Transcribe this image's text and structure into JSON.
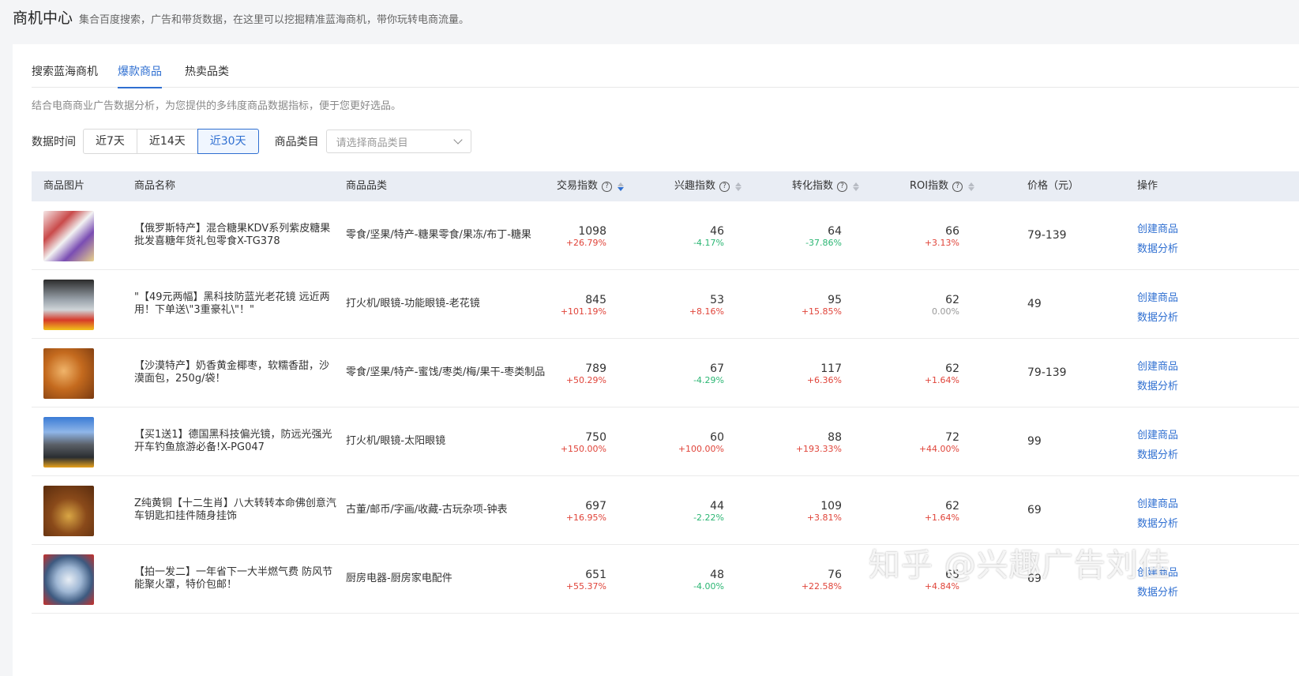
{
  "header": {
    "title": "商机中心",
    "description": "集合百度搜索，广告和带货数据，在这里可以挖掘精准蓝海商机，带你玩转电商流量。"
  },
  "tabs": [
    {
      "label": "搜索蓝海商机",
      "active": false
    },
    {
      "label": "爆款商品",
      "active": true
    },
    {
      "label": "热卖品类",
      "active": false
    }
  ],
  "subtitle": "结合电商商业广告数据分析，为您提供的多纬度商品数据指标，便于您更好选品。",
  "filters": {
    "time_label": "数据时间",
    "time_options": [
      "近7天",
      "近14天",
      "近30天"
    ],
    "time_selected": "近30天",
    "category_label": "商品类目",
    "category_placeholder": "请选择商品类目"
  },
  "table": {
    "columns": {
      "image": "商品图片",
      "name": "商品名称",
      "category": "商品品类",
      "trade": "交易指数",
      "interest": "兴趣指数",
      "conversion": "转化指数",
      "roi": "ROI指数",
      "price": "价格（元）",
      "ops": "操作"
    },
    "help_icon": "?",
    "rows": [
      {
        "name": "【俄罗斯特产】混合糖果KDV系列紫皮糖果批发喜糖年货礼包零食X-TG378",
        "category": "零食/坚果/特产-糖果零食/果冻/布丁-糖果",
        "trade": "1098",
        "trade_chg": "+26.79%",
        "interest": "46",
        "interest_chg": "-4.17%",
        "conversion": "64",
        "conversion_chg": "-37.86%",
        "roi": "66",
        "roi_chg": "+3.13%",
        "price": "79-139",
        "op1": "创建商品",
        "op2": "数据分析"
      },
      {
        "name": "\"【49元两幅】黑科技防蓝光老花镜 远近两用！下单送\\\"3重豪礼\\\"！\"",
        "category": "打火机/眼镜-功能眼镜-老花镜",
        "trade": "845",
        "trade_chg": "+101.19%",
        "interest": "53",
        "interest_chg": "+8.16%",
        "conversion": "95",
        "conversion_chg": "+15.85%",
        "roi": "62",
        "roi_chg": "0.00%",
        "price": "49",
        "op1": "创建商品",
        "op2": "数据分析"
      },
      {
        "name": "【沙漠特产】奶香黄金椰枣，软糯香甜，沙漠面包，250g/袋！",
        "category": "零食/坚果/特产-蜜饯/枣类/梅/果干-枣类制品",
        "trade": "789",
        "trade_chg": "+50.29%",
        "interest": "67",
        "interest_chg": "-4.29%",
        "conversion": "117",
        "conversion_chg": "+6.36%",
        "roi": "62",
        "roi_chg": "+1.64%",
        "price": "79-139",
        "op1": "创建商品",
        "op2": "数据分析"
      },
      {
        "name": "【买1送1】德国黑科技偏光镜，防远光强光开车钓鱼旅游必备!X-PG047",
        "category": "打火机/眼镜-太阳眼镜",
        "trade": "750",
        "trade_chg": "+150.00%",
        "interest": "60",
        "interest_chg": "+100.00%",
        "conversion": "88",
        "conversion_chg": "+193.33%",
        "roi": "72",
        "roi_chg": "+44.00%",
        "price": "99",
        "op1": "创建商品",
        "op2": "数据分析"
      },
      {
        "name": "Z纯黄铜【十二生肖】八大转转本命佛创意汽车钥匙扣挂件随身挂饰",
        "category": "古董/邮币/字画/收藏-古玩杂项-钟表",
        "trade": "697",
        "trade_chg": "+16.95%",
        "interest": "44",
        "interest_chg": "-2.22%",
        "conversion": "109",
        "conversion_chg": "+3.81%",
        "roi": "62",
        "roi_chg": "+1.64%",
        "price": "69",
        "op1": "创建商品",
        "op2": "数据分析"
      },
      {
        "name": "【拍一发二】一年省下一大半燃气费 防风节能聚火罩，特价包邮！",
        "category": "厨房电器-厨房家电配件",
        "trade": "651",
        "trade_chg": "+55.37%",
        "interest": "48",
        "interest_chg": "-4.00%",
        "conversion": "76",
        "conversion_chg": "+22.58%",
        "roi": "65",
        "roi_chg": "+4.84%",
        "price": "69",
        "op1": "创建商品",
        "op2": "数据分析"
      }
    ]
  },
  "watermark": "知乎 @兴趣广告刘佳",
  "colors": {
    "accent": "#2f6fd1",
    "increase": "#e0443a",
    "decrease": "#2bb673",
    "header_bg": "#e9edf4"
  }
}
